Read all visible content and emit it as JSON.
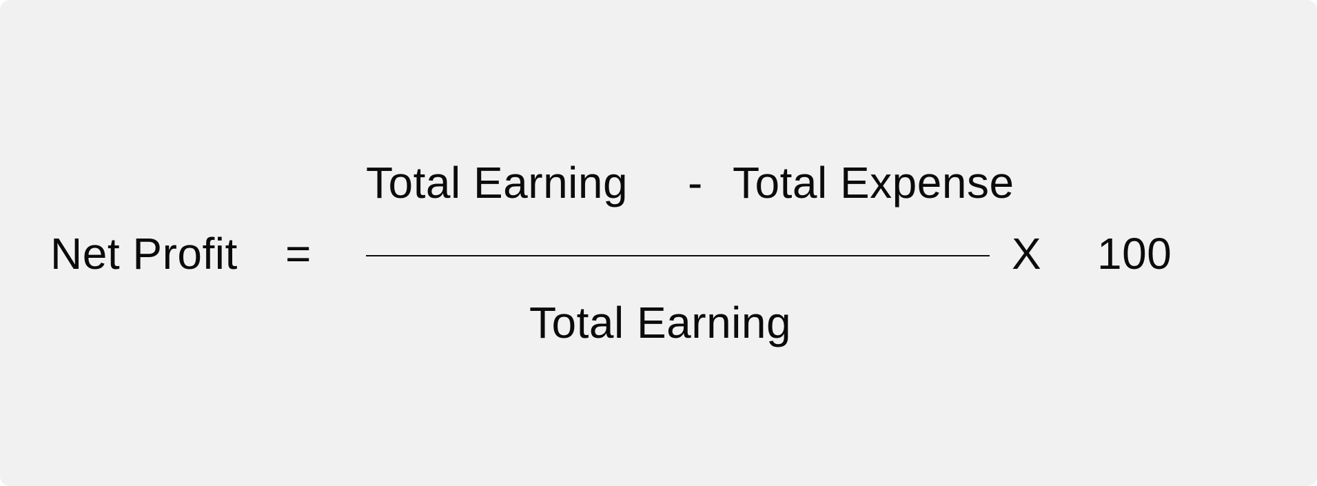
{
  "formula": {
    "lhs_label": "Net Profit",
    "equals_sign": "=",
    "numerator_term_a": "Total Earning",
    "minus_sign": "-",
    "numerator_term_b": "Total Expense",
    "denominator": "Total Earning",
    "multiply_sign": "X",
    "multiplier": "100"
  },
  "colors": {
    "background": "#f1f1f1",
    "text": "#0b0b0b"
  }
}
